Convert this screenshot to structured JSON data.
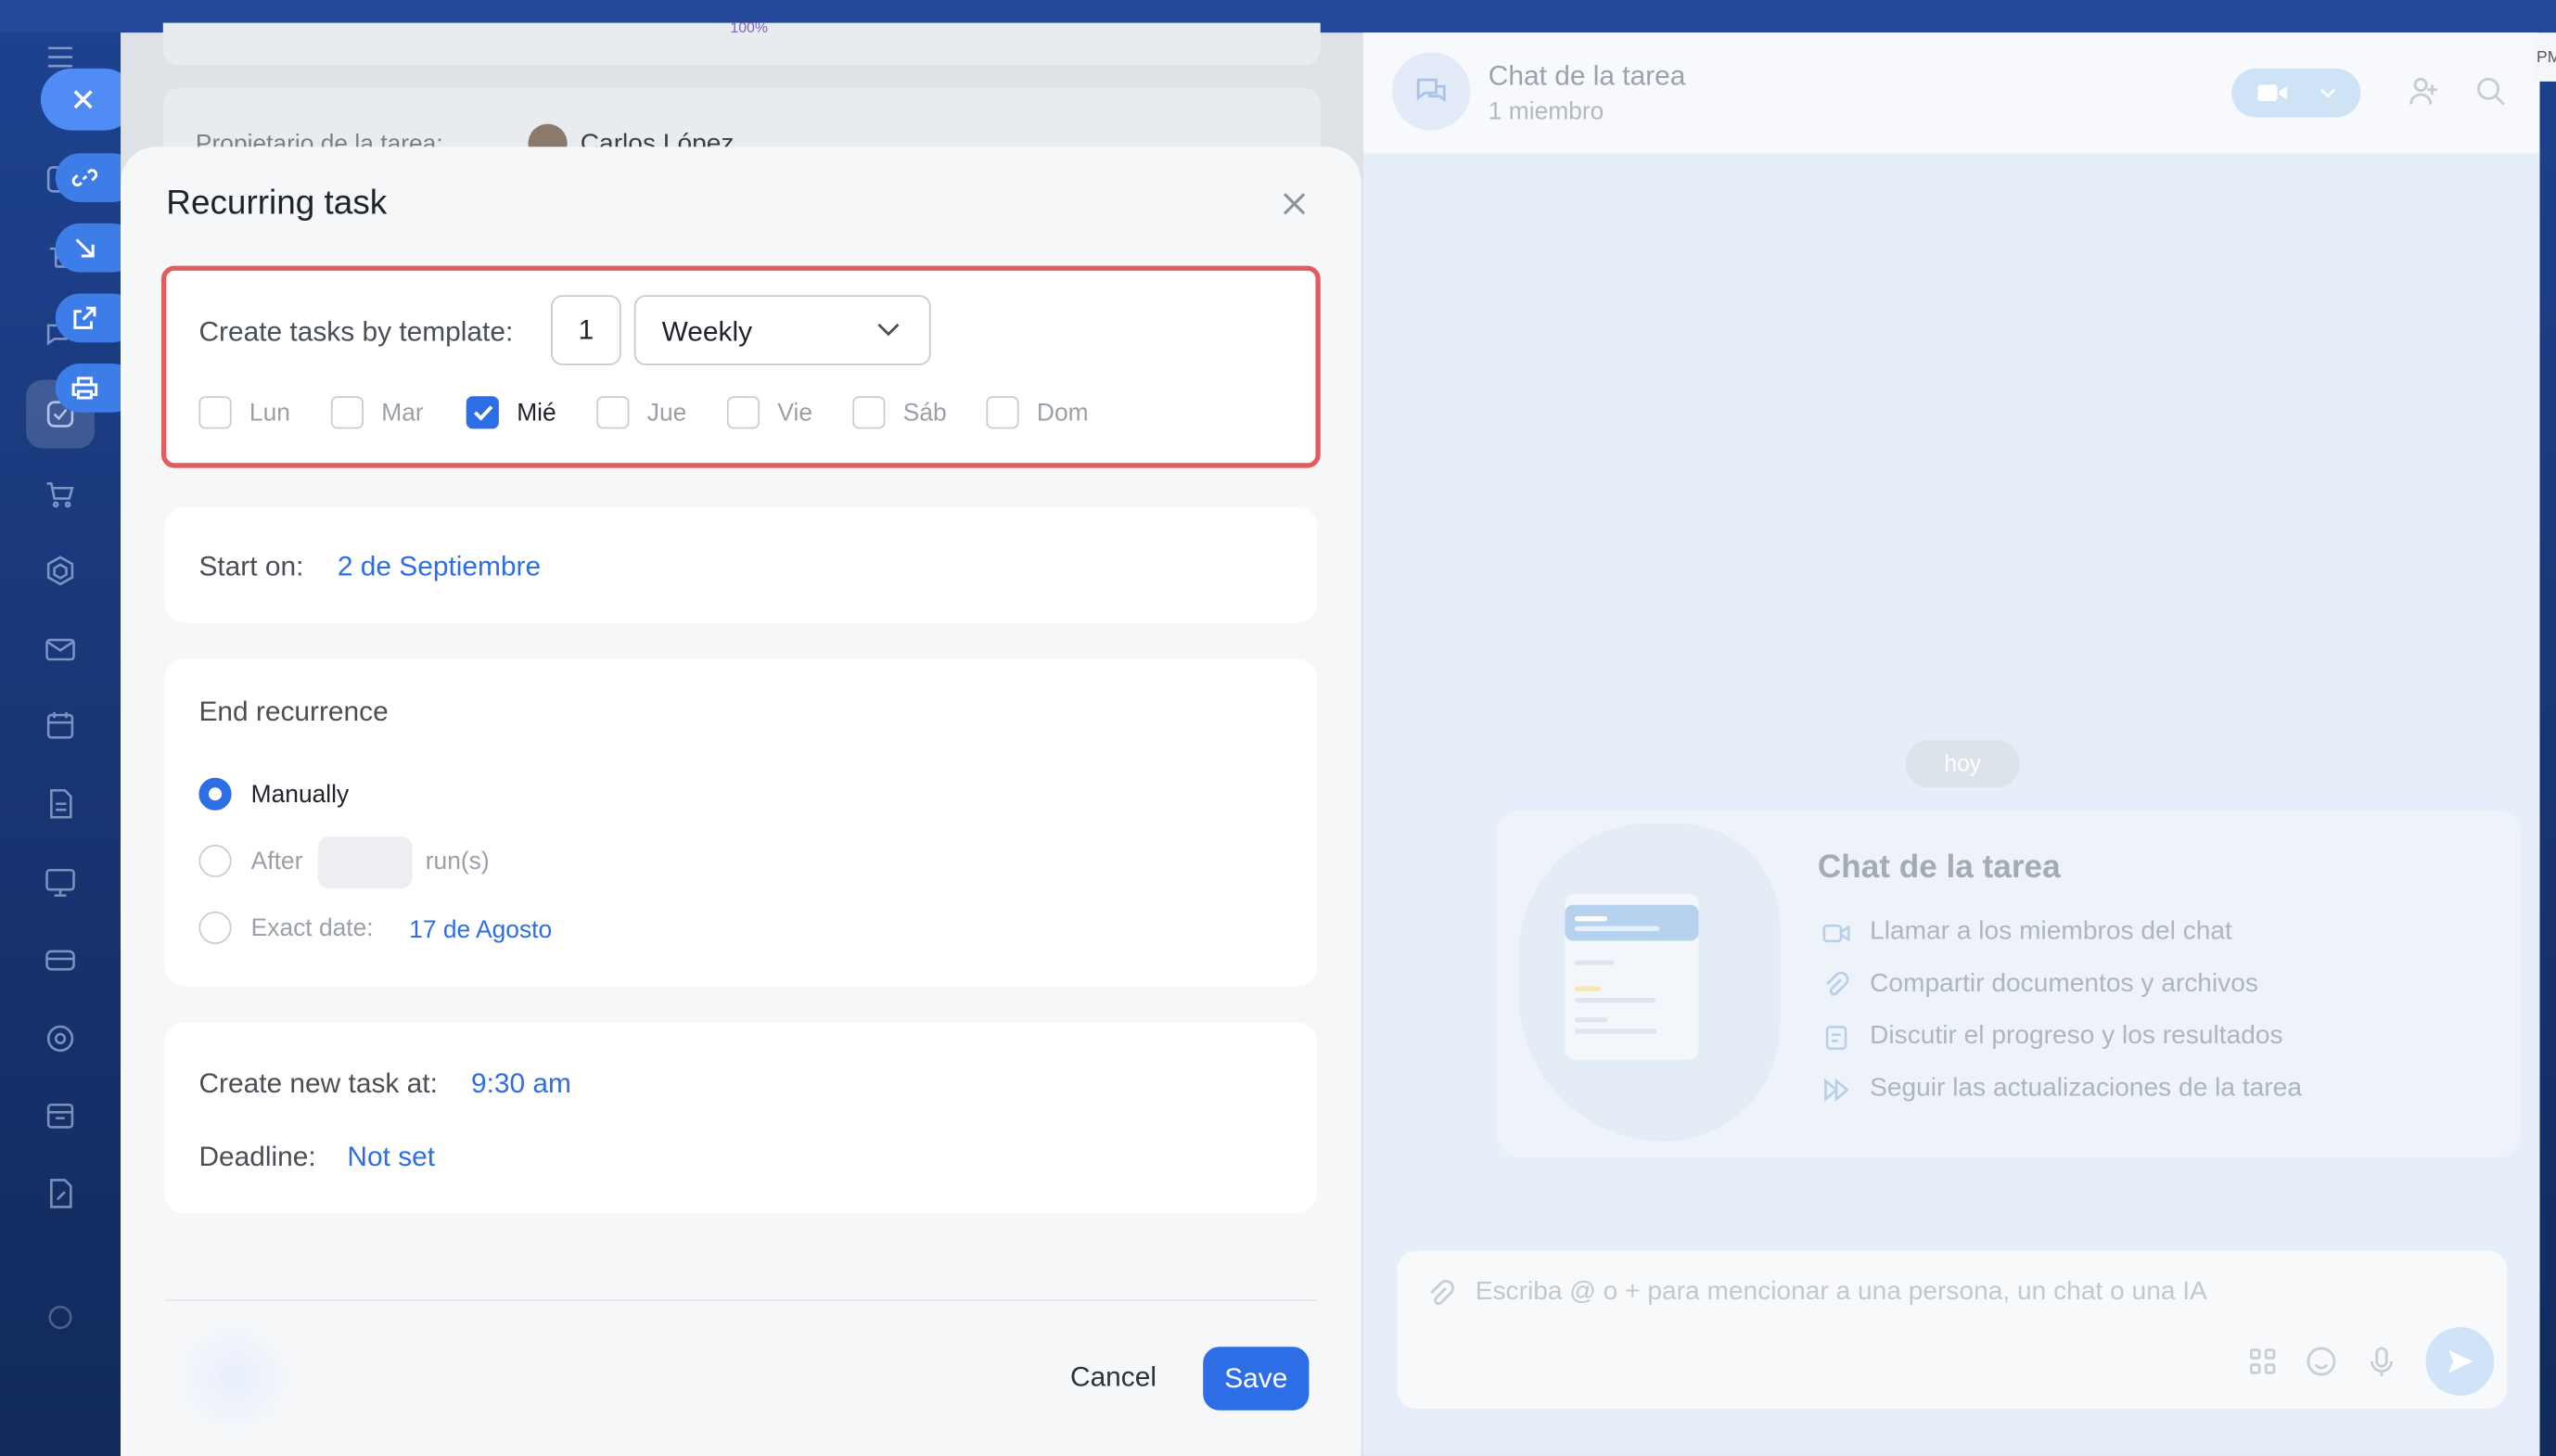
{
  "modal": {
    "title": "Recurring task",
    "template_label": "Create tasks by template:",
    "interval_value": "1",
    "frequency_value": "Weekly",
    "days": [
      {
        "label": "Lun",
        "checked": false
      },
      {
        "label": "Mar",
        "checked": false
      },
      {
        "label": "Mié",
        "checked": true
      },
      {
        "label": "Jue",
        "checked": false
      },
      {
        "label": "Vie",
        "checked": false
      },
      {
        "label": "Sáb",
        "checked": false
      },
      {
        "label": "Dom",
        "checked": false
      }
    ],
    "start_label": "Start on:",
    "start_value": "2 de Septiembre",
    "end_title": "End recurrence",
    "end_manually": "Manually",
    "end_after": "After",
    "end_after_suffix": "run(s)",
    "end_exact": "Exact date:",
    "end_exact_value": "17 de Agosto",
    "create_label": "Create new task at:",
    "create_value": "9:30 am",
    "deadline_label": "Deadline:",
    "deadline_value": "Not set",
    "cancel": "Cancel",
    "save": "Save"
  },
  "task": {
    "owner_label": "Propietario de la tarea:",
    "owner_name": "Carlos López",
    "progress_text": "100%"
  },
  "chat": {
    "title": "Chat de la tarea",
    "members": "1 miembro",
    "today": "hoy",
    "welcome_title": "Chat de la tarea",
    "welcome_items": [
      "Llamar a los miembros del chat",
      "Compartir documentos y archivos",
      "Discutir el progreso y los resultados",
      "Seguir las actualizaciones de la tarea"
    ],
    "composer_placeholder": "Escriba @ o + para mencionar a una persona, un chat o una IA",
    "edge_text": "PM"
  },
  "colors": {
    "accent": "#2d6ee6",
    "highlight_border": "#e35b5f",
    "sidebar": "#1e4290"
  }
}
